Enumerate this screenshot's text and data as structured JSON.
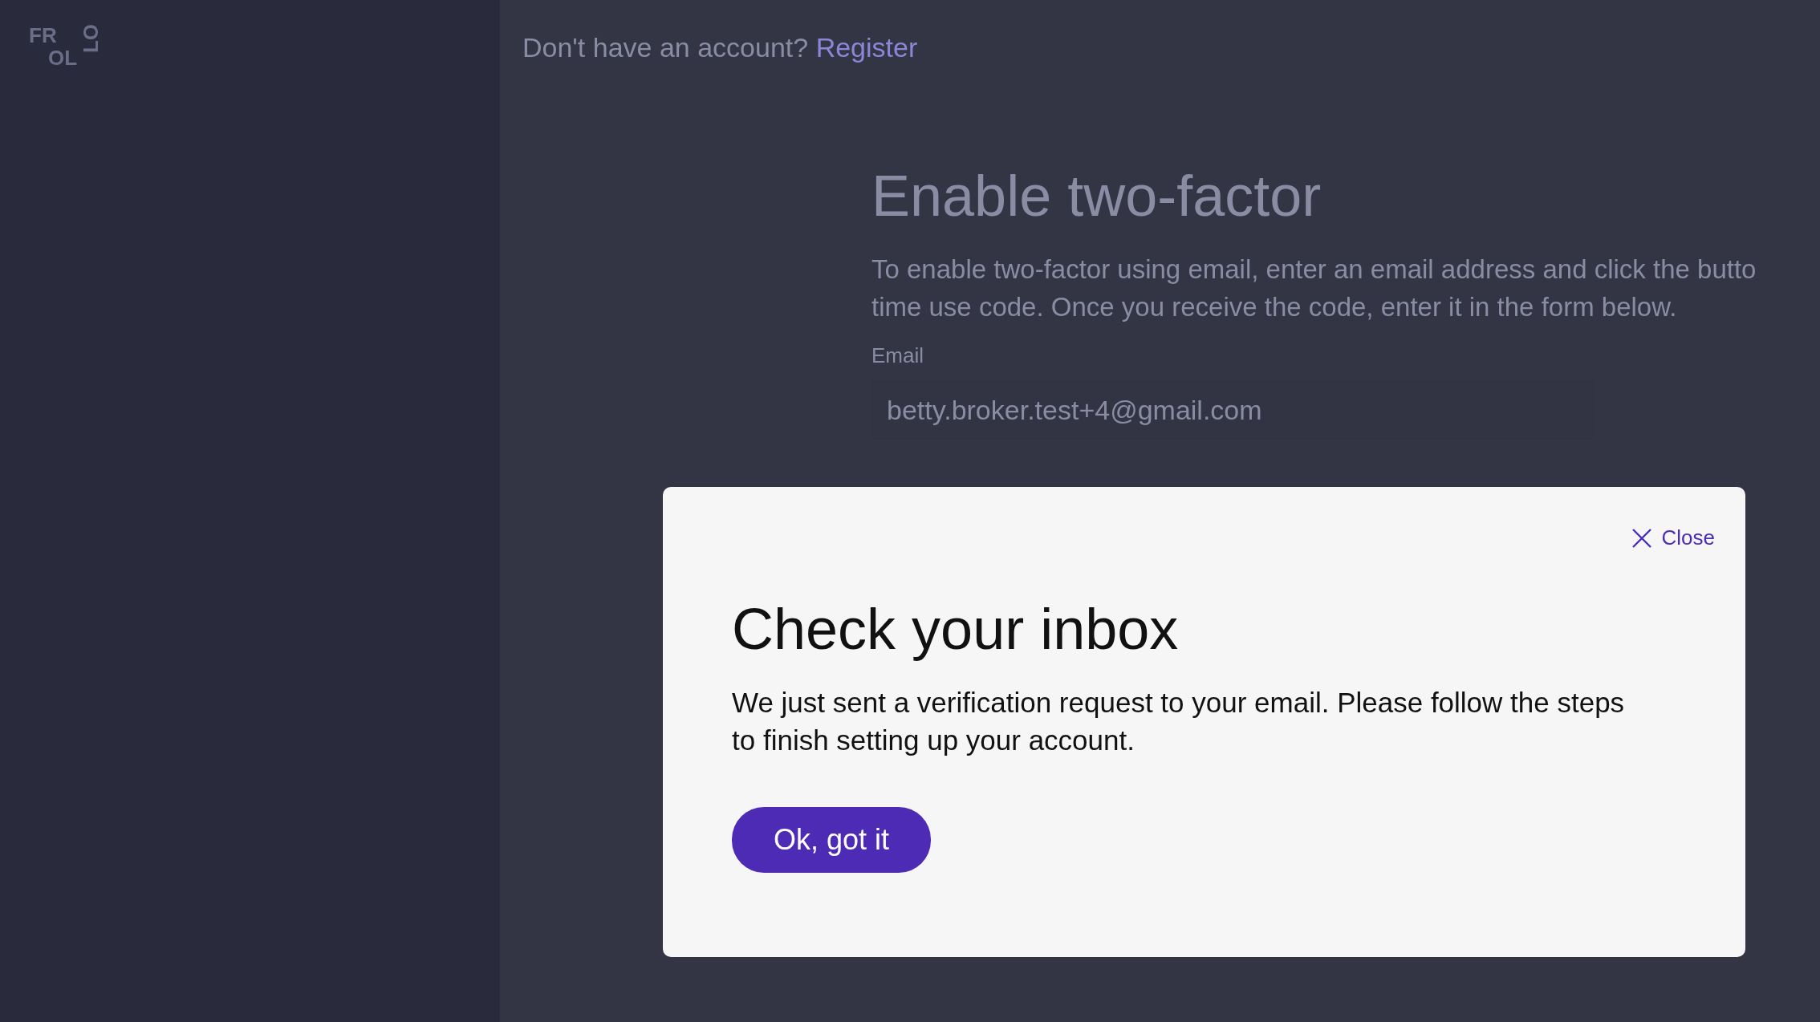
{
  "logo": {
    "lines": [
      "FR",
      "OL"
    ],
    "side": "LO"
  },
  "top_bar": {
    "prompt": "Don't have an account?",
    "link": "Register"
  },
  "form": {
    "title": "Enable two-factor",
    "description_lines": [
      "To enable two-factor using email, enter an email address and click the butto",
      "time use code. Once you receive the code, enter it in the form below."
    ],
    "email_label": "Email",
    "email_value": "betty.broker.test+4@gmail.com"
  },
  "modal": {
    "close_label": "Close",
    "title": "Check your inbox",
    "body": "We just sent a verification request to your email. Please follow the steps to finish setting up your account.",
    "button": "Ok, got it"
  }
}
